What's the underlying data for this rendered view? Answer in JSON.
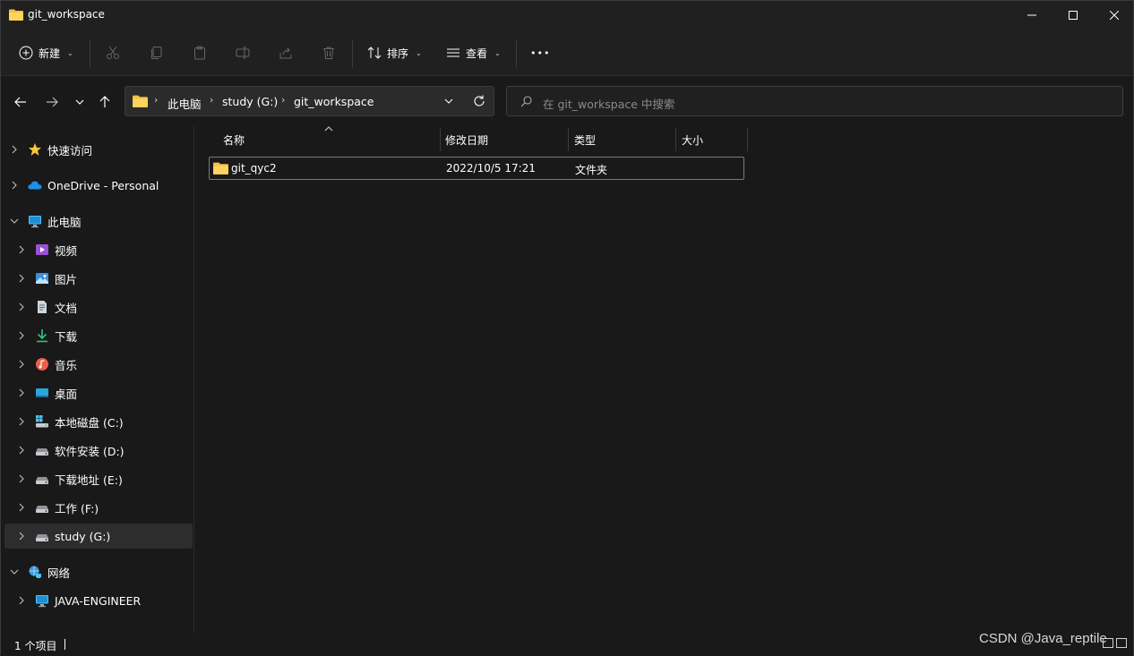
{
  "window": {
    "title": "git_workspace"
  },
  "toolbar": {
    "new_label": "新建",
    "sort_label": "排序",
    "view_label": "查看",
    "more_label": "•••"
  },
  "address": {
    "crumbs": [
      "此电脑",
      "study (G:)",
      "git_workspace"
    ]
  },
  "search": {
    "placeholder": "在 git_workspace 中搜索"
  },
  "sidebar": {
    "items": [
      {
        "label": "快速访问",
        "icon": "star-icon"
      },
      {
        "label": "OneDrive - Personal",
        "icon": "cloud-icon"
      },
      {
        "label": "此电脑",
        "icon": "computer-icon"
      },
      {
        "label": "视频",
        "icon": "video-icon"
      },
      {
        "label": "图片",
        "icon": "picture-icon"
      },
      {
        "label": "文档",
        "icon": "document-icon"
      },
      {
        "label": "下载",
        "icon": "download-icon"
      },
      {
        "label": "音乐",
        "icon": "music-icon"
      },
      {
        "label": "桌面",
        "icon": "desktop-icon"
      },
      {
        "label": "本地磁盘 (C:)",
        "icon": "system-drive-icon"
      },
      {
        "label": "软件安装 (D:)",
        "icon": "drive-icon"
      },
      {
        "label": "下载地址 (E:)",
        "icon": "drive-icon"
      },
      {
        "label": "工作 (F:)",
        "icon": "drive-icon"
      },
      {
        "label": "study (G:)",
        "icon": "drive-icon",
        "selected": true
      },
      {
        "label": "网络",
        "icon": "network-icon"
      },
      {
        "label": "JAVA-ENGINEER",
        "icon": "computer-icon"
      }
    ]
  },
  "columns": {
    "name": "名称",
    "modified": "修改日期",
    "type": "类型",
    "size": "大小"
  },
  "files": [
    {
      "name": "git_qyc2",
      "modified": "2022/10/5 17:21",
      "type": "文件夹",
      "size": ""
    }
  ],
  "status": {
    "count": "1 个项目"
  },
  "watermark": "CSDN @Java_reptile",
  "colors": {
    "background": "#191919",
    "chrome": "#202020",
    "folder": "#f4c043",
    "accent": "#4cc2ff"
  }
}
